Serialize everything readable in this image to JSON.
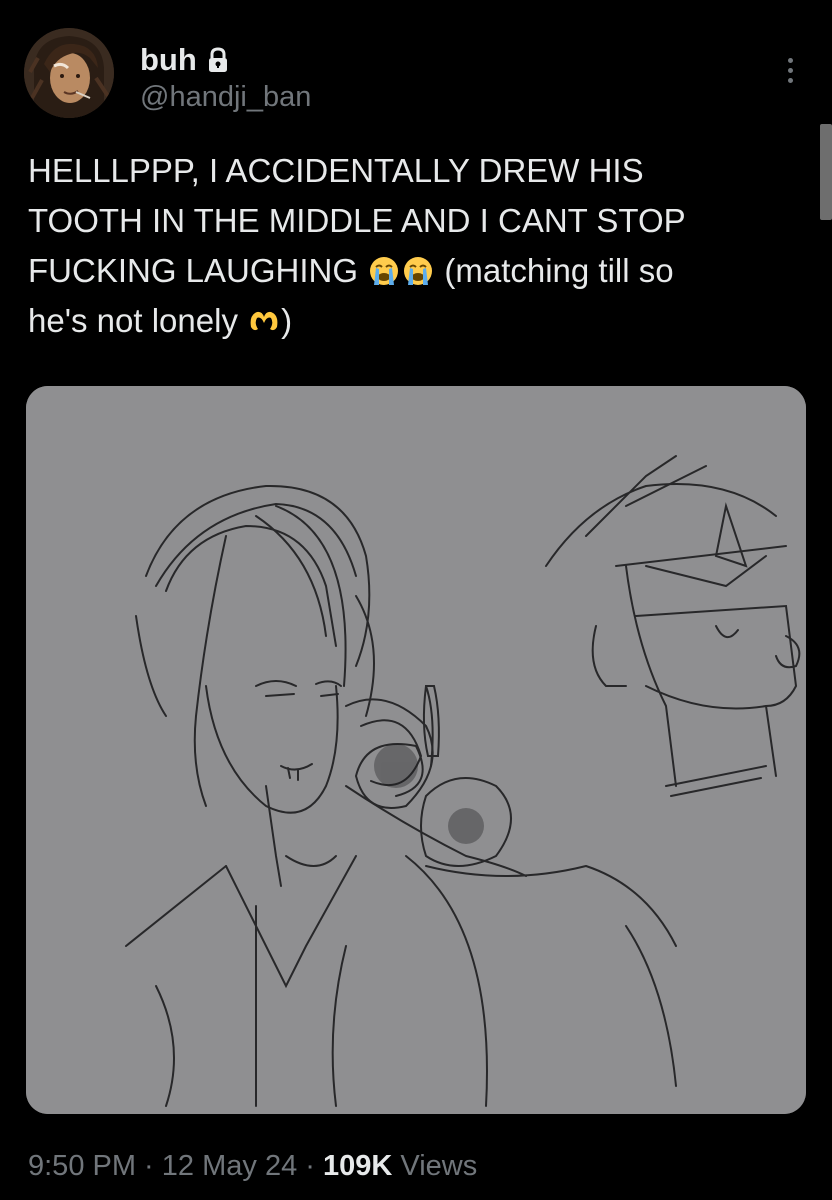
{
  "user": {
    "display_name": "buh",
    "handle": "@handji_ban",
    "protected_icon": "lock-icon",
    "avatar": "avatar"
  },
  "menu": {
    "more_icon": "more-options-icon"
  },
  "tweet": {
    "lines": [
      {
        "text": "HELLLPPP, I ACCIDENTALLY DREW HIS"
      },
      {
        "text": "TOOTH IN THE MIDDLE AND I CANT STOP"
      },
      {
        "text_before": "FUCKING LAUGHING ",
        "emoji": [
          "loudly-crying-face-emoji",
          "loudly-crying-face-emoji"
        ],
        "text_after": " (matching till so"
      },
      {
        "text_before": "he's not lonely ",
        "emoji": [
          "heart-hands-emoji"
        ],
        "text_after": ")"
      }
    ]
  },
  "media": {
    "kind": "pencil sketch photo"
  },
  "meta": {
    "time": "9:50 PM",
    "separator": " · ",
    "date": "12 May 24",
    "views_count": "109K",
    "views_label": " Views"
  },
  "colors": {
    "background": "#000000",
    "primary_text": "#e7e9ea",
    "secondary_text": "#71767b",
    "sketch_paper": "#8f8f91"
  }
}
